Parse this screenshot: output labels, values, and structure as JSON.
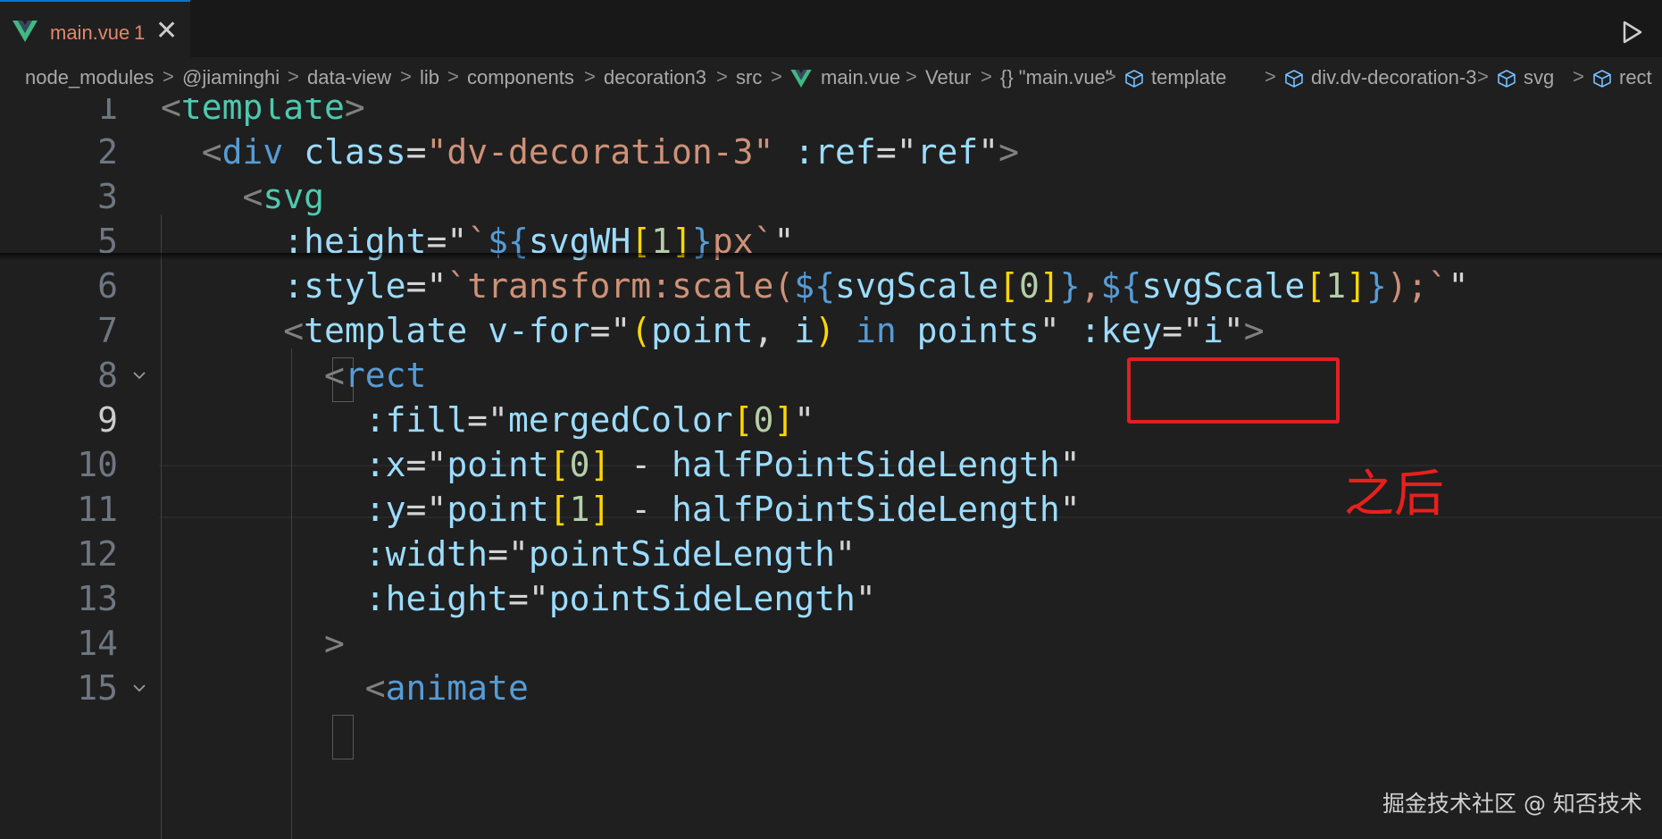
{
  "tab": {
    "filename": "main.vue",
    "badge": "1",
    "close": "✕"
  },
  "breadcrumb": {
    "items": [
      "node_modules",
      "@jiaminghi",
      "data-view",
      "lib",
      "components",
      "decoration3",
      "src",
      "main.vue",
      "Vetur",
      "{} \"main.vue\"",
      "template",
      "div.dv-decoration-3",
      "svg",
      "rect"
    ],
    "separator": ">"
  },
  "editor": {
    "active_line": "9",
    "lines": [
      {
        "num": "1",
        "tokens": [
          [
            "pu",
            "<"
          ],
          [
            "tg",
            "template"
          ],
          [
            "pu",
            ">"
          ]
        ]
      },
      {
        "num": "2",
        "tokens": [
          [
            "wh",
            "  "
          ],
          [
            "pu",
            "<"
          ],
          [
            "tb",
            "div"
          ],
          [
            "wh",
            " "
          ],
          [
            "at",
            "class"
          ],
          [
            "wh",
            "="
          ],
          [
            "st",
            "\"dv-decoration-3\""
          ],
          [
            "wh",
            " "
          ],
          [
            "at",
            ":ref"
          ],
          [
            "wh",
            "="
          ],
          [
            "wh",
            "\""
          ],
          [
            "vr",
            "ref"
          ],
          [
            "wh",
            "\""
          ],
          [
            "pu",
            ">"
          ]
        ]
      },
      {
        "num": "3",
        "tokens": [
          [
            "wh",
            "    "
          ],
          [
            "pu",
            "<"
          ],
          [
            "tg",
            "svg"
          ]
        ]
      },
      {
        "num": "5",
        "tokens": [
          [
            "wh",
            "      "
          ],
          [
            "at",
            ":height"
          ],
          [
            "wh",
            "=\""
          ],
          [
            "st",
            "`"
          ],
          [
            "kw",
            "${"
          ],
          [
            "vr",
            "svgWH"
          ],
          [
            "y",
            "["
          ],
          [
            "nm",
            "1"
          ],
          [
            "y",
            "]"
          ],
          [
            "kw",
            "}"
          ],
          [
            "st",
            "px`"
          ],
          [
            "wh",
            "\""
          ]
        ]
      },
      {
        "num": "6",
        "tokens": [
          [
            "wh",
            "      "
          ],
          [
            "at",
            ":style"
          ],
          [
            "wh",
            "=\""
          ],
          [
            "st",
            "`transform:scale("
          ],
          [
            "kw",
            "${"
          ],
          [
            "vr",
            "svgScale"
          ],
          [
            "y",
            "["
          ],
          [
            "nm",
            "0"
          ],
          [
            "y",
            "]"
          ],
          [
            "kw",
            "}"
          ],
          [
            "st",
            ","
          ],
          [
            "kw",
            "${"
          ],
          [
            "vr",
            "svgScale"
          ],
          [
            "y",
            "["
          ],
          [
            "nm",
            "1"
          ],
          [
            "y",
            "]"
          ],
          [
            "kw",
            "}"
          ],
          [
            "st",
            ");`"
          ],
          [
            "wh",
            "\""
          ]
        ]
      },
      {
        "num": "7",
        "tokens": [
          [
            "wh",
            "      "
          ],
          [
            "pu",
            "<"
          ],
          [
            "at",
            "template"
          ],
          [
            "wh",
            " "
          ],
          [
            "at",
            "v-for"
          ],
          [
            "wh",
            "=\""
          ],
          [
            "y",
            "("
          ],
          [
            "vr",
            "point"
          ],
          [
            "wh",
            ", "
          ],
          [
            "vr",
            "i"
          ],
          [
            "y",
            ")"
          ],
          [
            "wh",
            " "
          ],
          [
            "kw",
            "in"
          ],
          [
            "wh",
            " "
          ],
          [
            "vr",
            "points"
          ],
          [
            "wh",
            "\" "
          ],
          [
            "at",
            ":key"
          ],
          [
            "wh",
            "=\""
          ],
          [
            "vr",
            "i"
          ],
          [
            "wh",
            "\""
          ],
          [
            "pu",
            ">"
          ]
        ]
      },
      {
        "num": "8",
        "tokens": [
          [
            "wh",
            "        "
          ],
          [
            "pu",
            "<"
          ],
          [
            "tb",
            "rect"
          ]
        ]
      },
      {
        "num": "9",
        "tokens": [
          [
            "wh",
            "          "
          ],
          [
            "at",
            ":fill"
          ],
          [
            "wh",
            "=\""
          ],
          [
            "vr",
            "mergedColor"
          ],
          [
            "y",
            "["
          ],
          [
            "nm",
            "0"
          ],
          [
            "y",
            "]"
          ],
          [
            "wh",
            "\""
          ]
        ]
      },
      {
        "num": "10",
        "tokens": [
          [
            "wh",
            "          "
          ],
          [
            "at",
            ":x"
          ],
          [
            "wh",
            "=\""
          ],
          [
            "vr",
            "point"
          ],
          [
            "y",
            "["
          ],
          [
            "nm",
            "0"
          ],
          [
            "y",
            "]"
          ],
          [
            "wh",
            " - "
          ],
          [
            "vr",
            "halfPointSideLength"
          ],
          [
            "wh",
            "\""
          ]
        ]
      },
      {
        "num": "11",
        "tokens": [
          [
            "wh",
            "          "
          ],
          [
            "at",
            ":y"
          ],
          [
            "wh",
            "=\""
          ],
          [
            "vr",
            "point"
          ],
          [
            "y",
            "["
          ],
          [
            "nm",
            "1"
          ],
          [
            "y",
            "]"
          ],
          [
            "wh",
            " - "
          ],
          [
            "vr",
            "halfPointSideLength"
          ],
          [
            "wh",
            "\""
          ]
        ]
      },
      {
        "num": "12",
        "tokens": [
          [
            "wh",
            "          "
          ],
          [
            "at",
            ":width"
          ],
          [
            "wh",
            "=\""
          ],
          [
            "vr",
            "pointSideLength"
          ],
          [
            "wh",
            "\""
          ]
        ]
      },
      {
        "num": "13",
        "tokens": [
          [
            "wh",
            "          "
          ],
          [
            "at",
            ":height"
          ],
          [
            "wh",
            "=\""
          ],
          [
            "vr",
            "pointSideLength"
          ],
          [
            "wh",
            "\""
          ]
        ]
      },
      {
        "num": "14",
        "tokens": [
          [
            "wh",
            "        "
          ],
          [
            "pu",
            ">"
          ]
        ]
      },
      {
        "num": "15",
        "tokens": [
          [
            "wh",
            "          "
          ],
          [
            "pu",
            "<"
          ],
          [
            "tb",
            "animate"
          ]
        ]
      }
    ]
  },
  "annotation": {
    "text": "之后"
  },
  "watermark": {
    "text": "掘金技术社区 @ 知否技术"
  },
  "colors": {
    "accent": "#0078d4",
    "annotation_red": "#e02020",
    "vue_green": "#41b883"
  },
  "icons": [
    "vue-icon",
    "close-icon",
    "run-icon",
    "chevron-right-icon",
    "cube-icon",
    "fold-chevron-icon"
  ]
}
